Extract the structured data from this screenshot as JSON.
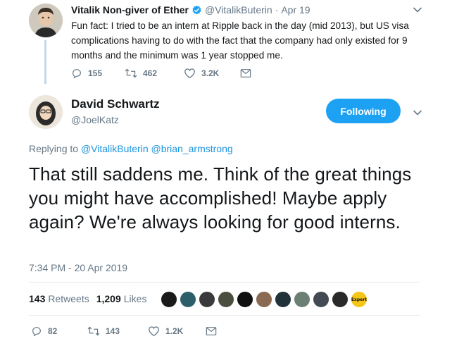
{
  "parent_tweet": {
    "author_name": "Vitalik Non-giver of Ether",
    "author_handle": "@VitalikButerin",
    "separator": "·",
    "date": "Apr 19",
    "text": "Fun fact: I tried to be an intern at Ripple back in the day (mid 2013), but US visa complications having to do with the fact that the company had only existed for 9 months and the minimum was 1 year stopped me.",
    "replies": "155",
    "retweets": "462",
    "likes": "3.2K"
  },
  "main_tweet": {
    "author_name": "David Schwartz",
    "author_handle": "@JoelKatz",
    "follow_label": "Following",
    "replying_prefix": "Replying to",
    "replying_to": [
      "@VitalikButerin",
      "@brian_armstrong"
    ],
    "text": "That still saddens me. Think of the great things you might have accomplished! Maybe apply again? We're always looking for good interns.",
    "timestamp": "7:34 PM - 20 Apr 2019",
    "retweet_count": "143",
    "retweet_label": "Retweets",
    "like_count": "1,209",
    "like_label": "Likes",
    "expert_badge": "Expert",
    "replies": "82",
    "retweets": "143",
    "likes": "1.2K"
  },
  "colors": {
    "accent": "#1da1f2",
    "link": "#1b95e0",
    "secondary_text": "#657786",
    "thread_line": "#c4d7e6"
  },
  "icons": [
    "reply-icon",
    "retweet-icon",
    "like-icon",
    "dm-icon",
    "verified-icon",
    "caret-down-icon"
  ]
}
